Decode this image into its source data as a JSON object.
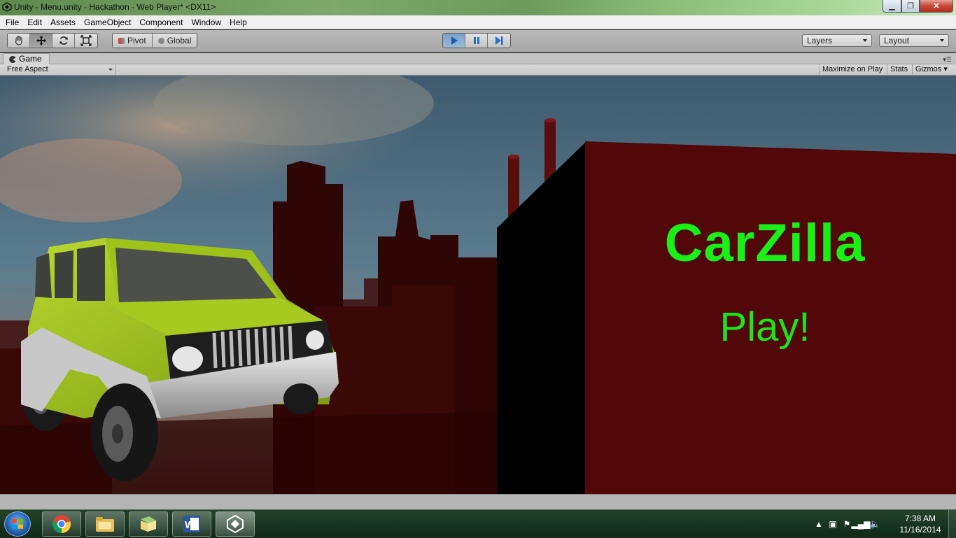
{
  "window": {
    "title": "Unity - Menu.unity - Hackathon - Web Player* <DX11>",
    "minimize_label": "▁",
    "maximize_label": "❐",
    "close_label": "✕"
  },
  "menubar": {
    "items": [
      "File",
      "Edit",
      "Assets",
      "GameObject",
      "Component",
      "Window",
      "Help"
    ]
  },
  "toolbar": {
    "tools": [
      "hand-icon",
      "move-icon",
      "rotate-icon",
      "scale-icon"
    ],
    "pivot_label": "Pivot",
    "global_label": "Global",
    "play_controls": [
      "play-icon",
      "pause-icon",
      "step-icon"
    ],
    "layers_label": "Layers",
    "layout_label": "Layout"
  },
  "game_panel": {
    "tab_label": "Game",
    "aspect_label": "Free Aspect",
    "maximize_on_play_label": "Maximize on Play",
    "stats_label": "Stats",
    "gizmos_label": "Gizmos"
  },
  "game_scene": {
    "title": "CarZilla",
    "play_label": "Play!",
    "title_color": "#18f018"
  },
  "taskbar": {
    "apps": [
      "chrome-icon",
      "file-explorer-icon",
      "folder-files-icon",
      "word-icon",
      "unity-icon"
    ],
    "clock_time": "7:38 AM",
    "clock_date": "11/16/2014"
  }
}
